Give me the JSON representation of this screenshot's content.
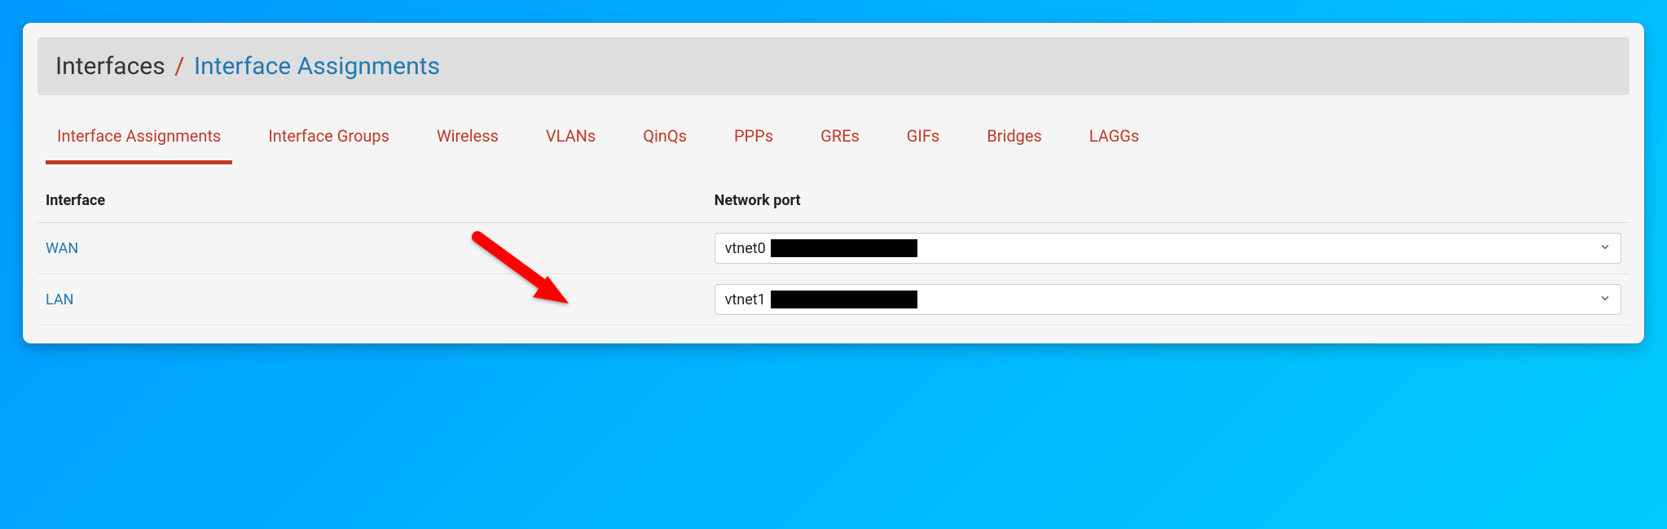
{
  "breadcrumb": {
    "root": "Interfaces",
    "separator": "/",
    "current": "Interface Assignments"
  },
  "tabs": [
    {
      "label": "Interface Assignments",
      "active": true
    },
    {
      "label": "Interface Groups",
      "active": false
    },
    {
      "label": "Wireless",
      "active": false
    },
    {
      "label": "VLANs",
      "active": false
    },
    {
      "label": "QinQs",
      "active": false
    },
    {
      "label": "PPPs",
      "active": false
    },
    {
      "label": "GREs",
      "active": false
    },
    {
      "label": "GIFs",
      "active": false
    },
    {
      "label": "Bridges",
      "active": false
    },
    {
      "label": "LAGGs",
      "active": false
    }
  ],
  "columns": {
    "interface": "Interface",
    "network_port": "Network port"
  },
  "rows": [
    {
      "interface": "WAN",
      "port_value": "vtnet0",
      "redacted": true
    },
    {
      "interface": "LAN",
      "port_value": "vtnet1",
      "redacted": true
    }
  ]
}
